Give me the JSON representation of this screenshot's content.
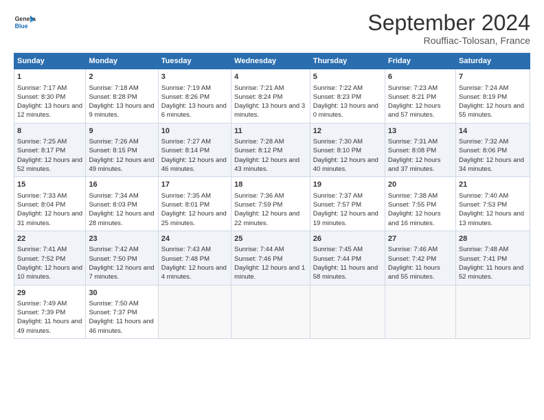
{
  "header": {
    "logo_line1": "General",
    "logo_line2": "Blue",
    "title": "September 2024",
    "subtitle": "Rouffiac-Tolosan, France"
  },
  "days_of_week": [
    "Sunday",
    "Monday",
    "Tuesday",
    "Wednesday",
    "Thursday",
    "Friday",
    "Saturday"
  ],
  "weeks": [
    [
      {
        "day": 1,
        "sunrise": "Sunrise: 7:17 AM",
        "sunset": "Sunset: 8:30 PM",
        "daylight": "Daylight: 13 hours and 12 minutes."
      },
      {
        "day": 2,
        "sunrise": "Sunrise: 7:18 AM",
        "sunset": "Sunset: 8:28 PM",
        "daylight": "Daylight: 13 hours and 9 minutes."
      },
      {
        "day": 3,
        "sunrise": "Sunrise: 7:19 AM",
        "sunset": "Sunset: 8:26 PM",
        "daylight": "Daylight: 13 hours and 6 minutes."
      },
      {
        "day": 4,
        "sunrise": "Sunrise: 7:21 AM",
        "sunset": "Sunset: 8:24 PM",
        "daylight": "Daylight: 13 hours and 3 minutes."
      },
      {
        "day": 5,
        "sunrise": "Sunrise: 7:22 AM",
        "sunset": "Sunset: 8:23 PM",
        "daylight": "Daylight: 13 hours and 0 minutes."
      },
      {
        "day": 6,
        "sunrise": "Sunrise: 7:23 AM",
        "sunset": "Sunset: 8:21 PM",
        "daylight": "Daylight: 12 hours and 57 minutes."
      },
      {
        "day": 7,
        "sunrise": "Sunrise: 7:24 AM",
        "sunset": "Sunset: 8:19 PM",
        "daylight": "Daylight: 12 hours and 55 minutes."
      }
    ],
    [
      {
        "day": 8,
        "sunrise": "Sunrise: 7:25 AM",
        "sunset": "Sunset: 8:17 PM",
        "daylight": "Daylight: 12 hours and 52 minutes."
      },
      {
        "day": 9,
        "sunrise": "Sunrise: 7:26 AM",
        "sunset": "Sunset: 8:15 PM",
        "daylight": "Daylight: 12 hours and 49 minutes."
      },
      {
        "day": 10,
        "sunrise": "Sunrise: 7:27 AM",
        "sunset": "Sunset: 8:14 PM",
        "daylight": "Daylight: 12 hours and 46 minutes."
      },
      {
        "day": 11,
        "sunrise": "Sunrise: 7:28 AM",
        "sunset": "Sunset: 8:12 PM",
        "daylight": "Daylight: 12 hours and 43 minutes."
      },
      {
        "day": 12,
        "sunrise": "Sunrise: 7:30 AM",
        "sunset": "Sunset: 8:10 PM",
        "daylight": "Daylight: 12 hours and 40 minutes."
      },
      {
        "day": 13,
        "sunrise": "Sunrise: 7:31 AM",
        "sunset": "Sunset: 8:08 PM",
        "daylight": "Daylight: 12 hours and 37 minutes."
      },
      {
        "day": 14,
        "sunrise": "Sunrise: 7:32 AM",
        "sunset": "Sunset: 8:06 PM",
        "daylight": "Daylight: 12 hours and 34 minutes."
      }
    ],
    [
      {
        "day": 15,
        "sunrise": "Sunrise: 7:33 AM",
        "sunset": "Sunset: 8:04 PM",
        "daylight": "Daylight: 12 hours and 31 minutes."
      },
      {
        "day": 16,
        "sunrise": "Sunrise: 7:34 AM",
        "sunset": "Sunset: 8:03 PM",
        "daylight": "Daylight: 12 hours and 28 minutes."
      },
      {
        "day": 17,
        "sunrise": "Sunrise: 7:35 AM",
        "sunset": "Sunset: 8:01 PM",
        "daylight": "Daylight: 12 hours and 25 minutes."
      },
      {
        "day": 18,
        "sunrise": "Sunrise: 7:36 AM",
        "sunset": "Sunset: 7:59 PM",
        "daylight": "Daylight: 12 hours and 22 minutes."
      },
      {
        "day": 19,
        "sunrise": "Sunrise: 7:37 AM",
        "sunset": "Sunset: 7:57 PM",
        "daylight": "Daylight: 12 hours and 19 minutes."
      },
      {
        "day": 20,
        "sunrise": "Sunrise: 7:38 AM",
        "sunset": "Sunset: 7:55 PM",
        "daylight": "Daylight: 12 hours and 16 minutes."
      },
      {
        "day": 21,
        "sunrise": "Sunrise: 7:40 AM",
        "sunset": "Sunset: 7:53 PM",
        "daylight": "Daylight: 12 hours and 13 minutes."
      }
    ],
    [
      {
        "day": 22,
        "sunrise": "Sunrise: 7:41 AM",
        "sunset": "Sunset: 7:52 PM",
        "daylight": "Daylight: 12 hours and 10 minutes."
      },
      {
        "day": 23,
        "sunrise": "Sunrise: 7:42 AM",
        "sunset": "Sunset: 7:50 PM",
        "daylight": "Daylight: 12 hours and 7 minutes."
      },
      {
        "day": 24,
        "sunrise": "Sunrise: 7:43 AM",
        "sunset": "Sunset: 7:48 PM",
        "daylight": "Daylight: 12 hours and 4 minutes."
      },
      {
        "day": 25,
        "sunrise": "Sunrise: 7:44 AM",
        "sunset": "Sunset: 7:46 PM",
        "daylight": "Daylight: 12 hours and 1 minute."
      },
      {
        "day": 26,
        "sunrise": "Sunrise: 7:45 AM",
        "sunset": "Sunset: 7:44 PM",
        "daylight": "Daylight: 11 hours and 58 minutes."
      },
      {
        "day": 27,
        "sunrise": "Sunrise: 7:46 AM",
        "sunset": "Sunset: 7:42 PM",
        "daylight": "Daylight: 11 hours and 55 minutes."
      },
      {
        "day": 28,
        "sunrise": "Sunrise: 7:48 AM",
        "sunset": "Sunset: 7:41 PM",
        "daylight": "Daylight: 11 hours and 52 minutes."
      }
    ],
    [
      {
        "day": 29,
        "sunrise": "Sunrise: 7:49 AM",
        "sunset": "Sunset: 7:39 PM",
        "daylight": "Daylight: 11 hours and 49 minutes."
      },
      {
        "day": 30,
        "sunrise": "Sunrise: 7:50 AM",
        "sunset": "Sunset: 7:37 PM",
        "daylight": "Daylight: 11 hours and 46 minutes."
      },
      null,
      null,
      null,
      null,
      null
    ]
  ]
}
